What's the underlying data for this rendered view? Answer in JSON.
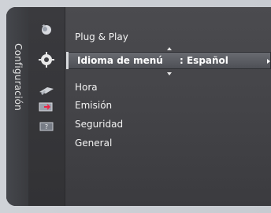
{
  "sidebar": {
    "title": "Configuración",
    "icons": [
      {
        "name": "picture-icon"
      },
      {
        "name": "setup-gear-icon"
      },
      {
        "name": "channel-antenna-icon"
      },
      {
        "name": "input-icon"
      },
      {
        "name": "support-icon"
      }
    ]
  },
  "menu": {
    "items": [
      {
        "label": "Plug & Play"
      },
      {
        "label": "Idioma de menú",
        "value": ": Español",
        "selected": true
      },
      {
        "label": "Hora"
      },
      {
        "label": "Emisión"
      },
      {
        "label": "Seguridad"
      },
      {
        "label": "General"
      }
    ]
  },
  "colors": {
    "panel": "#4a4a4e",
    "highlight": "#6a6c72",
    "text": "#f2f2f2"
  }
}
